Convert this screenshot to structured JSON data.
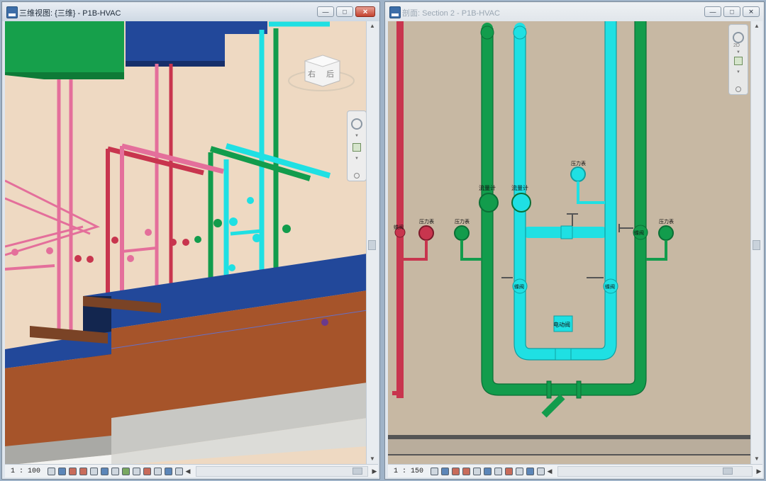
{
  "left_window": {
    "title": "三维视图: {三维} - P1B-HVAC",
    "scale": "1 : 100",
    "view_cube": {
      "left_label": "右",
      "right_label": "后"
    }
  },
  "right_window": {
    "title": "剖面: Section 2 - P1B-HVAC",
    "scale": "1 : 150",
    "labels": {
      "pressure_gauge": "压力表",
      "flow_meter": "流量计",
      "electric_valve": "电动阀",
      "butterfly_valve": "蝶阀",
      "check_valve": "止回阀"
    },
    "nav_label": "2D"
  },
  "window_buttons": {
    "minimize": "—",
    "maximize": "□",
    "close": "✕"
  },
  "icons": {
    "app": "revit-app-icon",
    "view_cube": "view-cube-icon",
    "steering_wheel": "steering-wheel-icon",
    "zoom": "zoom-region-icon"
  },
  "colors": {
    "pipe_green": "#129c4c",
    "pipe_cyan": "#1fe0e3",
    "pipe_pink": "#e46f9b",
    "pipe_red": "#c8354e",
    "duct_orange": "#a6542a",
    "duct_blue": "#22489a",
    "wall_section": "#c7b8a3",
    "wall_3d": "#eed9c2"
  }
}
